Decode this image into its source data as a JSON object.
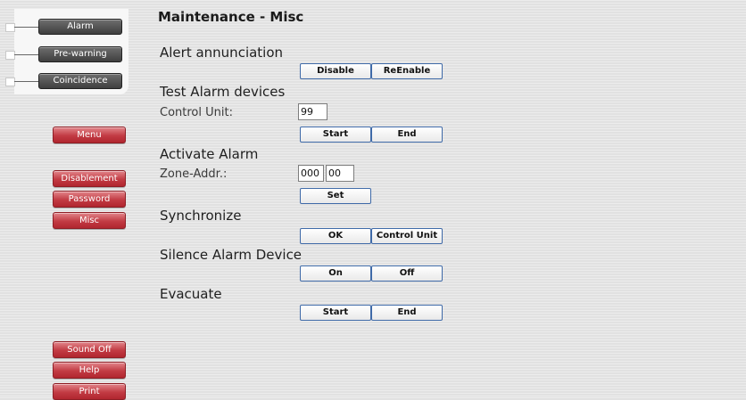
{
  "status": {
    "items": [
      {
        "label": "Alarm"
      },
      {
        "label": "Pre-warning"
      },
      {
        "label": "Coincidence"
      }
    ]
  },
  "nav": {
    "menu": "Menu",
    "disablement": "Disablement",
    "password": "Password",
    "misc": "Misc",
    "sound_off": "Sound Off",
    "help": "Help",
    "print": "Print"
  },
  "page": {
    "title": "Maintenance - Misc"
  },
  "sections": {
    "alert": {
      "title": "Alert annunciation",
      "disable": "Disable",
      "reenable": "ReEnable"
    },
    "test": {
      "title": "Test Alarm devices",
      "control_unit_label": "Control Unit:",
      "control_unit_value": "99",
      "start": "Start",
      "end": "End"
    },
    "activate": {
      "title": "Activate Alarm",
      "zone_label": "Zone-Addr.:",
      "zone_value": "000",
      "addr_value": "00",
      "set": "Set"
    },
    "sync": {
      "title": "Synchronize",
      "ok": "OK",
      "control_unit": "Control Unit"
    },
    "silence": {
      "title": "Silence Alarm Device",
      "on": "On",
      "off": "Off"
    },
    "evacuate": {
      "title": "Evacuate",
      "start": "Start",
      "end": "End"
    }
  },
  "colors": {
    "nav_red": "#c23b43",
    "status_dark": "#4f4f4f",
    "button_border": "#3f6aa8"
  }
}
